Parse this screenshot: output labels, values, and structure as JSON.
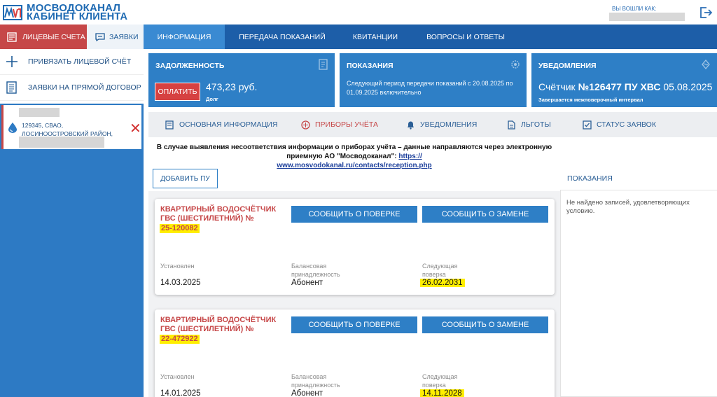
{
  "header": {
    "logo_line1": "МОСВОДОКАНАЛ",
    "logo_line2": "КАБИНЕТ КЛИЕНТА",
    "logged_in_label": "ВЫ ВОШЛИ КАК:"
  },
  "sidebar": {
    "tab_accounts": "ЛИЦЕВЫЕ СЧЕТА",
    "tab_requests": "ЗАЯВКИ",
    "items": [
      {
        "label": "ПРИВЯЗАТЬ ЛИЦЕВОЙ СЧЁТ",
        "icon": "plus-icon"
      },
      {
        "label": "ЗАЯВКИ НА ПРЯМОЙ ДОГОВОР",
        "icon": "document-list-icon"
      }
    ],
    "account": {
      "address_line1": "129345, СВАО,",
      "address_line2": "ЛОСИНООСТРОВСКИЙ РАЙОН,",
      "remove_glyph": "✕"
    }
  },
  "nav": {
    "tabs": [
      "ИНФОРМАЦИЯ",
      "ПЕРЕДАЧА ПОКАЗАНИЙ",
      "КВИТАНЦИИ",
      "ВОПРОСЫ И ОТВЕТЫ"
    ],
    "active": "ИНФОРМАЦИЯ"
  },
  "cards": {
    "debt": {
      "title": "ЗАДОЛЖЕННОСТЬ",
      "pay_label": "ОПЛАТИТЬ",
      "amount": "473,23 руб.",
      "sub": "Долг"
    },
    "readings": {
      "title": "ПОКАЗАНИЯ",
      "text": "Следующий период передачи показаний с 20.08.2025 по 01.09.2025 включительно"
    },
    "notifications": {
      "title": "УВЕДОМЛЕНИЯ",
      "prefix": "Счётчик",
      "meter": "№126477 ПУ ХВС",
      "date": "05.08.2025",
      "sub": "Завершается межповерочный интервал"
    }
  },
  "subtabs": [
    {
      "label": "ОСНОВНАЯ ИНФОРМАЦИЯ",
      "icon": "info-book-icon"
    },
    {
      "label": "ПРИБОРЫ УЧЁТА",
      "icon": "gauge-icon"
    },
    {
      "label": "УВЕДОМЛЕНИЯ",
      "icon": "bell-icon"
    },
    {
      "label": "ЛЬГОТЫ",
      "icon": "document-icon"
    },
    {
      "label": "СТАТУС ЗАЯВОК",
      "icon": "status-icon"
    }
  ],
  "notice": {
    "text": "В случае выявления несоответствия информации о приборах учёта – данные направляются через электронную приемную АО \"Мосводоканал\": ",
    "link": "https://www.mosvodokanal.ru/contacts/reception.php",
    "link_line1": "https://",
    "link_line2": "www.mosvodokanal.ru/contacts/reception.php"
  },
  "add_button": "ДОБАВИТЬ ПУ",
  "meters": [
    {
      "title": "КВАРТИРНЫЙ ВОДОСЧЁТЧИК ГВС (ШЕСТИЛЕТНИЙ) №",
      "number": "25-120082",
      "btn_verify": "СООБЩИТЬ О ПОВЕРКЕ",
      "btn_replace": "СООБЩИТЬ О ЗАМЕНЕ",
      "installed_label": "Установлен",
      "installed": "14.03.2025",
      "owner_label_1": "Балансовая",
      "owner_label_2": "принадлежность",
      "owner": "Абонент",
      "next_label_1": "Следующая",
      "next_label_2": "поверка",
      "next": "26.02.2031"
    },
    {
      "title": "КВАРТИРНЫЙ ВОДОСЧЁТЧИК ГВС (ШЕСТИЛЕТНИЙ) №",
      "number": "22-472922",
      "btn_verify": "СООБЩИТЬ О ПОВЕРКЕ",
      "btn_replace": "СООБЩИТЬ О ЗАМЕНЕ",
      "installed_label": "Установлен",
      "installed": "14.01.2025",
      "owner_label_1": "Балансовая",
      "owner_label_2": "принадлежность",
      "owner": "Абонент",
      "next_label_1": "Следующая",
      "next_label_2": "поверка",
      "next": "14.11.2028"
    }
  ],
  "readings_panel": {
    "title": "ПОКАЗАНИЯ",
    "empty": "Не найдено записей, удовлетворяющих условию."
  },
  "colors": {
    "brand_blue": "#1d5ea8",
    "card_blue": "#2e7fc6",
    "accent_red": "#c64748",
    "highlight": "#ffee00"
  }
}
